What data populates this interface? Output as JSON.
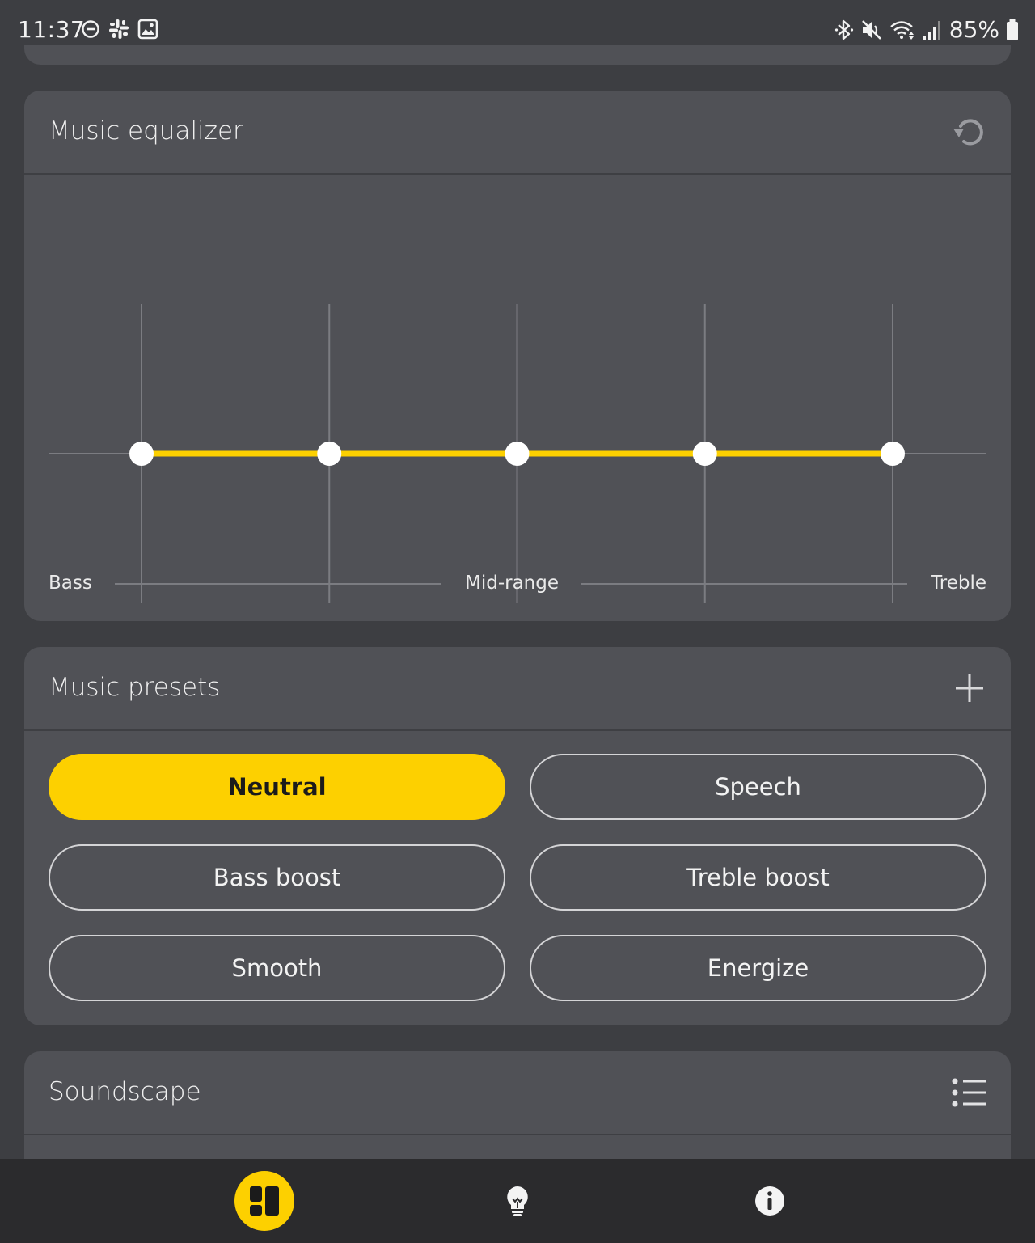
{
  "status_bar": {
    "time": "11:37",
    "battery": "85%"
  },
  "equalizer": {
    "title": "Music equalizer",
    "band_labels": {
      "bass": "Bass",
      "mid": "Mid-range",
      "treble": "Treble"
    },
    "bands": [
      0,
      0,
      0,
      0,
      0
    ],
    "accent_color": "#fdd000"
  },
  "presets": {
    "title": "Music presets",
    "items": [
      {
        "label": "Neutral",
        "selected": true
      },
      {
        "label": "Speech",
        "selected": false
      },
      {
        "label": "Bass boost",
        "selected": false
      },
      {
        "label": "Treble boost",
        "selected": false
      },
      {
        "label": "Smooth",
        "selected": false
      },
      {
        "label": "Energize",
        "selected": false
      }
    ]
  },
  "soundscape": {
    "title": "Soundscape"
  },
  "nav": {
    "items": [
      {
        "icon": "dashboard-icon",
        "active": true
      },
      {
        "icon": "lightbulb-icon",
        "active": false
      },
      {
        "icon": "info-icon",
        "active": false
      }
    ]
  },
  "colors": {
    "background": "#3d3e42",
    "card": "#505156",
    "accent": "#fdd000",
    "nav_bar": "#2b2b2d"
  }
}
